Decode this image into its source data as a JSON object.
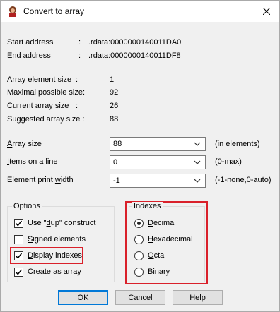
{
  "window": {
    "title": "Convert to array"
  },
  "addresses": {
    "start_label": "Start address",
    "start_sep": ":",
    "start_value": ".rdata:0000000140011DA0",
    "end_label": "End address",
    "end_sep": ":",
    "end_value": ".rdata:0000000140011DF8"
  },
  "sizes": {
    "element_label": "Array element size",
    "element_sep": ":",
    "element_value": "1",
    "maximal_label": "Maximal possible size:",
    "maximal_value": "92",
    "current_label": "Current array size",
    "current_sep": ":",
    "current_value": "26",
    "suggested_label": "Suggested array size :",
    "suggested_value": "88"
  },
  "fields": {
    "array_size": {
      "label_u": "A",
      "label_rest": "rray size",
      "value": "88",
      "hint": "(in elements)"
    },
    "items_on_line": {
      "label_u": "I",
      "label_rest": "tems on a line",
      "value": "0",
      "hint": "(0-max)"
    },
    "print_width": {
      "label_pre": "Element print ",
      "label_u": "w",
      "label_rest": "idth",
      "value": "-1",
      "hint": "(-1-none,0-auto)"
    }
  },
  "options": {
    "title": "Options",
    "use_dup": {
      "pre": "Use \"",
      "u": "d",
      "rest": "up\" construct",
      "checked": true
    },
    "signed": {
      "pre": "",
      "u": "S",
      "rest": "igned elements",
      "checked": false
    },
    "display_indexes": {
      "pre": "",
      "u": "D",
      "rest": "isplay indexes",
      "checked": true
    },
    "create_array": {
      "pre": "",
      "u": "C",
      "rest": "reate as array",
      "checked": true
    }
  },
  "indexes": {
    "title": "Indexes",
    "decimal": {
      "pre": "",
      "u": "D",
      "rest": "ecimal",
      "selected": true
    },
    "hex": {
      "pre": "",
      "u": "H",
      "rest": "exadecimal",
      "selected": false
    },
    "octal": {
      "pre": "",
      "u": "O",
      "rest": "ctal",
      "selected": false
    },
    "binary": {
      "pre": "",
      "u": "B",
      "rest": "inary",
      "selected": false
    }
  },
  "buttons": {
    "ok_u": "O",
    "ok_rest": "K",
    "cancel": "Cancel",
    "help": "Help"
  },
  "colors": {
    "highlight": "#d9202a",
    "default_button_border": "#0078d7"
  }
}
